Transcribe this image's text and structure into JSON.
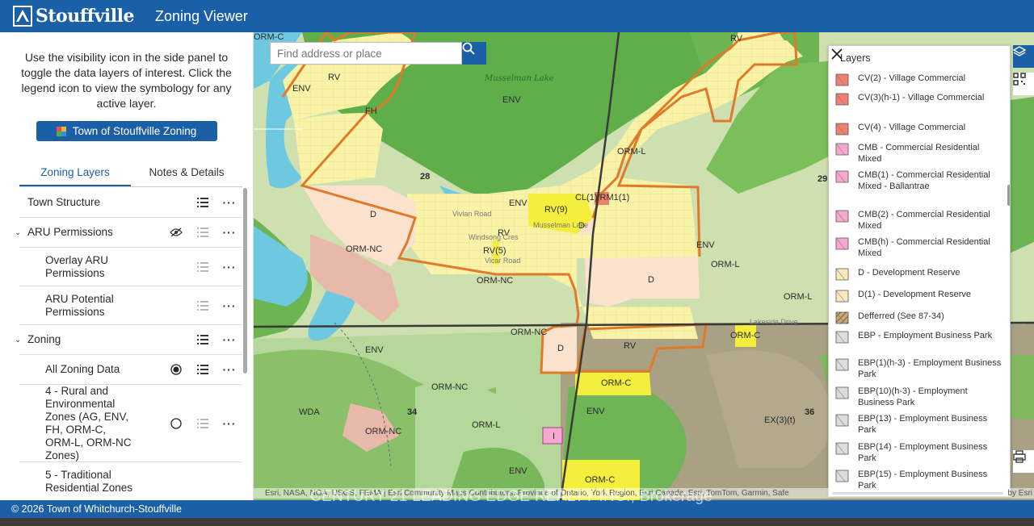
{
  "header": {
    "logo_text": "Stouffville",
    "app_title": "Zoning Viewer",
    "bg_color": "#1b5fa6"
  },
  "left_panel": {
    "intro": "Use the visibility icon in the side panel to toggle the data layers of interest. Click the legend icon to view the symbology for any active layer.",
    "zoning_button": "Town of Stouffville Zoning",
    "tabs": [
      {
        "label": "Zoning Layers",
        "active": true
      },
      {
        "label": "Notes & Details",
        "active": false
      }
    ],
    "layers": [
      {
        "label": "Town Structure"
      },
      {
        "label": "ARU Permissions"
      },
      {
        "label": "Overlay ARU Permissions"
      },
      {
        "label": "ARU Potential Permissions"
      },
      {
        "label": "Zoning"
      },
      {
        "label": "All Zoning Data"
      },
      {
        "label": "4 - Rural and Environmental Zones (AG, ENV, FH, ORM-C, ORM-L, ORM-NC Zones)"
      },
      {
        "label": "5 - Traditional Residential Zones"
      }
    ]
  },
  "map": {
    "search_placeholder": "Find address or place",
    "attribution": "Esri, NASA, NGA, USGS, FEMA | Esri Community Maps Contributors, Province of Ontario, York Region, Esri Canada, Esri, TomTom, Garmin, Safe",
    "attribution_tail": "by Esri",
    "lake_name": "Musselman Lake",
    "labels": {
      "ormc_tl": "ORM-C",
      "rv_tr": "RV",
      "env1": "ENV",
      "rv1": "RV",
      "fh": "FH",
      "env2": "ENV",
      "n28": "28",
      "d1": "D",
      "env3": "ENV",
      "rv9": "RV(9)",
      "cl1": "CL(1)/RM1(1)",
      "d2": "D",
      "rv2": "RV",
      "rv5": "RV(5)",
      "ormnc1": "ORM-NC",
      "ormnc2": "ORM-NC",
      "orml1": "ORM-L",
      "env4": "ENV",
      "orml2": "ORM-L",
      "d3": "D",
      "orml3": "ORM-L",
      "n29": "29",
      "ormnc3": "ORM-NC",
      "d4": "D",
      "rv3": "RV",
      "ormc2": "ORM-C",
      "env5": "ENV",
      "ormc3": "ORM-C",
      "ormnc4": "ORM-NC",
      "env6": "ENV",
      "wda": "WDA",
      "n34": "34",
      "ormnc5": "ORM-NC",
      "orml4": "ORM-L",
      "i": "I",
      "ex3": "EX(3)(t)",
      "n36": "36",
      "env7": "ENV",
      "ormc4": "ORM-C",
      "road1": "Windsong Cres",
      "road2": "Vicar Road",
      "road3": "Vivian Road",
      "road4": "Musselman Lake",
      "road5": "Lakeside Drive"
    }
  },
  "legend": {
    "title": "Layers",
    "items": [
      {
        "label": "CV(2) - Village Commercial",
        "color": "#f08070",
        "pattern": "solid"
      },
      {
        "label": "CV(3)(h-1) - Village Commercial",
        "color": "#f08070",
        "pattern": "solid"
      },
      {
        "label": "CV(4) - Village Commercial",
        "color": "#f08070",
        "pattern": "solid"
      },
      {
        "label": "CMB - Commercial Residential Mixed",
        "color": "#f7a8d0",
        "pattern": "solid"
      },
      {
        "label": "CMB(1) - Commercial Residential Mixed - Ballantrae",
        "color": "#f7a8d0",
        "pattern": "solid"
      },
      {
        "label": "CMB(2) - Commercial Residential Mixed",
        "color": "#f7a8d0",
        "pattern": "solid"
      },
      {
        "label": "CMB(h) - Commercial Residential Mixed",
        "color": "#f7a8d0",
        "pattern": "solid"
      },
      {
        "label": "D - Development Reserve",
        "color": "#fbe9bd",
        "pattern": "solid"
      },
      {
        "label": "D(1) - Development Reserve",
        "color": "#fbe9bd",
        "pattern": "solid"
      },
      {
        "label": "Defferred (See 87-34)",
        "color": "#b39a7a",
        "pattern": "hatch"
      },
      {
        "label": "EBP - Employment Business Park",
        "color": "#dcdcdc",
        "pattern": "solid"
      },
      {
        "label": "EBP(1)(h-3) - Employment Business Park",
        "color": "#dcdcdc",
        "pattern": "solid"
      },
      {
        "label": "EBP(10)(h-3) - Employment Business Park",
        "color": "#dcdcdc",
        "pattern": "solid"
      },
      {
        "label": "EBP(13) - Employment Business Park",
        "color": "#dcdcdc",
        "pattern": "solid"
      },
      {
        "label": "EBP(14) - Employment Business Park",
        "color": "#dcdcdc",
        "pattern": "solid"
      },
      {
        "label": "EBP(15) - Employment Business Park",
        "color": "#dcdcdc",
        "pattern": "solid"
      }
    ]
  },
  "footer": {
    "text": "© 2026 Town of Whitchurch-Stouffville",
    "watermark": "CENTURY 21 LEADING EDGE REALTY INC., Brokerage"
  },
  "colors": {
    "primary": "#1b5fa6",
    "boundary": "#e07a2a",
    "residential": "#f9f3a8",
    "yellow_zone": "#f4ef3c",
    "water": "#6ec9e0"
  }
}
